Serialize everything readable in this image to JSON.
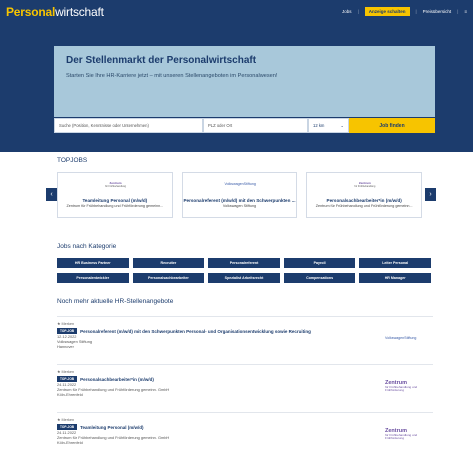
{
  "header": {
    "logo_bold": "Personal",
    "logo_rest": "wirtschaft",
    "nav": {
      "jobs": "Jobs",
      "post_ad": "Anzeige schalten",
      "prices": "Preisübersicht",
      "menu_icon": "≡"
    }
  },
  "hero": {
    "title": "Der Stellenmarkt der Personalwirtschaft",
    "subtitle": "Starten Sie Ihre HR-Karriere jetzt – mit unseren Stellenangeboten im Personalwesen!",
    "search_placeholder": "Suche (Position, Kenntnisse oder Unternehmen)",
    "location_placeholder": "PLZ oder Ort",
    "radius": "12 km",
    "find_button": "Job finden"
  },
  "topjobs": {
    "heading": "TOPJOBS",
    "cards": [
      {
        "title": "Teamleitung Personal (m/w/d)",
        "company": "Zentrum für Frühbehandlung und Frühförderung gemeinn...",
        "logo_a": "Zentrum",
        "logo_b": "für Frühbehandlung"
      },
      {
        "title": "Personalreferent (m/w/d) mit den Schwerpunkten ...",
        "company": "Volkswagen Stiftung",
        "logo_a": "VolkswagenStiftung",
        "logo_b": ""
      },
      {
        "title": "Personalsachbearbeiter*in (m/w/d)",
        "company": "Zentrum für Frühbehandlung und Frühförderung gemeinn...",
        "logo_a": "Zentrum",
        "logo_b": "für Frühbehandlung"
      }
    ]
  },
  "categories": {
    "heading": "Jobs nach Kategorie",
    "items": [
      "HR Business Partner",
      "Recruiter",
      "Personalreferent",
      "Payroll",
      "Leiter Personal",
      "Personalentwickler",
      "Personalsachbearbeiter",
      "Spezialist Arbeitsrecht",
      "Compensations",
      "HR Manager"
    ]
  },
  "listings": {
    "heading": "Noch mehr aktuelle HR-Stellenangebote",
    "items": [
      {
        "remember": "Merken",
        "badge": "TOP-JOB",
        "title": "Personalreferent (m/w/d) mit den Schwerpunkten Personal- und Organisationsentwicklung sowie Recruiting",
        "date": "12.12.2022",
        "company": "Volkswagen Stiftung",
        "location": "Hannover",
        "logo": "VolkswagenStiftung"
      },
      {
        "remember": "Merken",
        "badge": "TOP-JOB",
        "title": "Personalsachbearbeiter*in (m/w/d)",
        "date": "24.11.2022",
        "company": "Zentrum für Frühbehandlung und Frühförderung gemeinn. GmbH",
        "location": "Köln-Ehrenfeld",
        "logo": "Zentrum"
      },
      {
        "remember": "Merken",
        "badge": "TOP-JOB",
        "title": "Teamleitung Personal (m/w/d)",
        "date": "24.11.2022",
        "company": "Zentrum für Frühbehandlung und Frühförderung gemeinn. GmbH",
        "location": "Köln-Ehrenfeld",
        "logo": "Zentrum"
      }
    ],
    "logo_zentrum_sub": "für Frühbehandlung und Frühförderung"
  },
  "colors": {
    "primary": "#1c3c6d",
    "accent": "#f7c400",
    "hero_box": "#a8c8da"
  }
}
